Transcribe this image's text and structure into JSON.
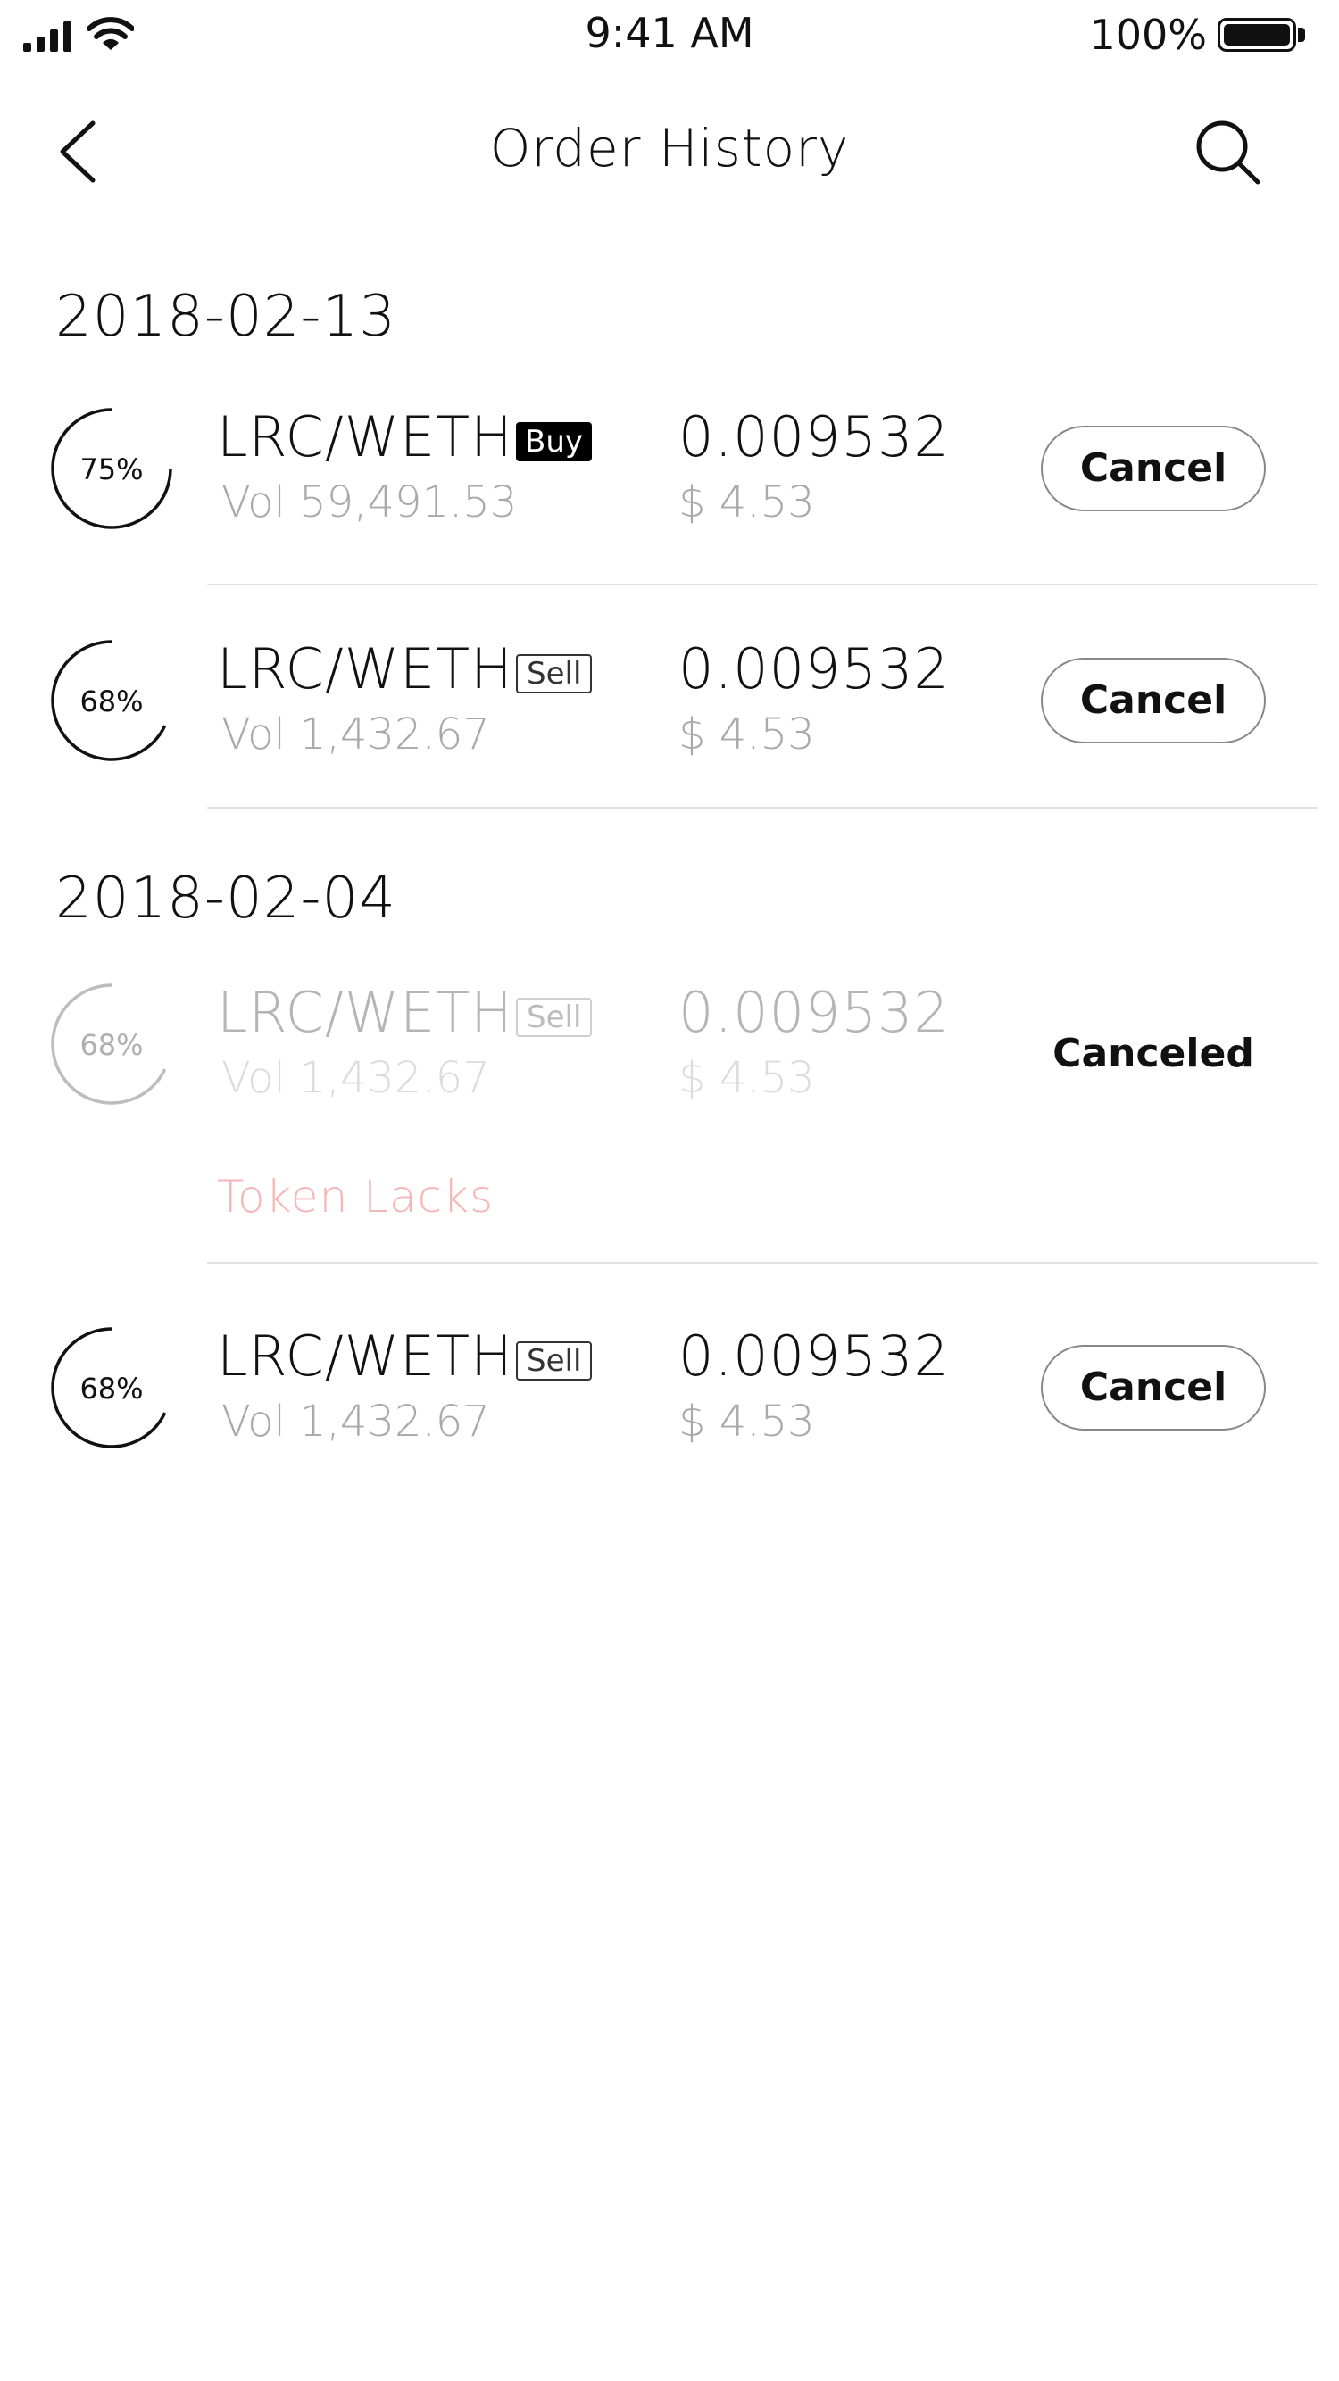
{
  "status_bar": {
    "time": "9:41 AM",
    "battery": "100%"
  },
  "nav": {
    "title": "Order History"
  },
  "sections": [
    {
      "date": "2018-02-13",
      "orders": [
        {
          "percent_label": "75%",
          "fill": 0.75,
          "pair": "LRC/WETH",
          "side": "Buy",
          "volume": "Vol 59,491.53",
          "price": "0.009532",
          "usd": "$ 4.53",
          "action": "Cancel"
        },
        {
          "percent_label": "68%",
          "fill": 0.68,
          "pair": "LRC/WETH",
          "side": "Sell",
          "volume": "Vol 1,432.67",
          "price": "0.009532",
          "usd": "$ 4.53",
          "action": "Cancel"
        }
      ]
    },
    {
      "date": "2018-02-04",
      "orders": [
        {
          "percent_label": "68%",
          "fill": 0.68,
          "pair": "LRC/WETH",
          "side": "Sell",
          "volume": "Vol 1,432.67",
          "price": "0.009532",
          "usd": "$ 4.53",
          "status": "Canceled",
          "error": "Token Lacks"
        },
        {
          "percent_label": "68%",
          "fill": 0.68,
          "pair": "LRC/WETH",
          "side": "Sell",
          "volume": "Vol 1,432.67",
          "price": "0.009532",
          "usd": "$ 4.53",
          "action": "Cancel"
        }
      ]
    }
  ],
  "colors": {
    "error": "#f4b6b6",
    "muted": "#a9a9a9",
    "divider": "#e2e2e2"
  }
}
